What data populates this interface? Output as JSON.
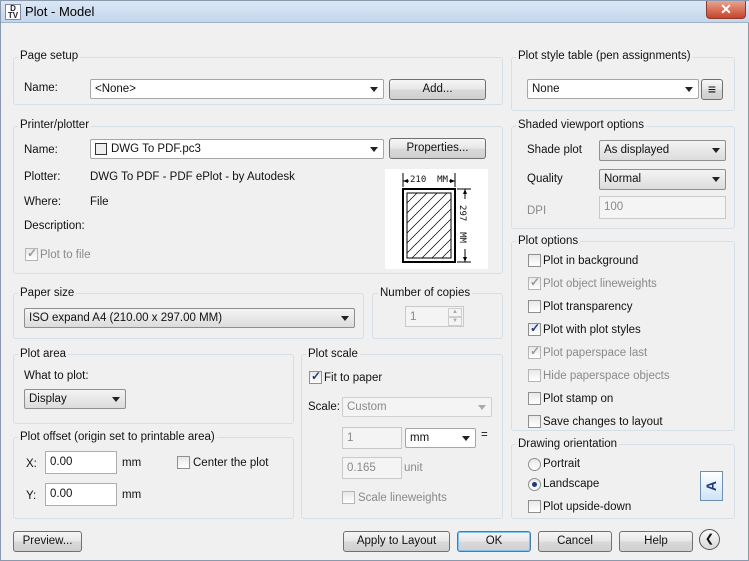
{
  "window": {
    "title": "Plot - Model",
    "app_icon": "D\nTV",
    "close_glyph": "✕"
  },
  "page_setup": {
    "group": "Page setup",
    "name_label": "Name:",
    "name_value": "<None>",
    "add_button": "Add..."
  },
  "printer": {
    "group": "Printer/plotter",
    "name_label": "Name:",
    "name_value": "DWG To PDF.pc3",
    "properties_button": "Properties...",
    "plotter_label": "Plotter:",
    "plotter_value": "DWG To PDF - PDF ePlot - by Autodesk",
    "where_label": "Where:",
    "where_value": "File",
    "description_label": "Description:",
    "plot_to_file": "Plot to file",
    "plot_to_file_checked": true,
    "preview": {
      "width_text": "210  MM",
      "height_text": "297  MM"
    }
  },
  "paper_size": {
    "group": "Paper size",
    "value": "ISO expand A4 (210.00 x 297.00 MM)"
  },
  "copies": {
    "group": "Number of copies",
    "value": "1"
  },
  "plot_area": {
    "group": "Plot area",
    "what_label": "What to plot:",
    "what_value": "Display"
  },
  "plot_offset": {
    "group": "Plot offset (origin set to printable area)",
    "x_label": "X:",
    "x_value": "0.00",
    "x_unit": "mm",
    "y_label": "Y:",
    "y_value": "0.00",
    "y_unit": "mm",
    "center_label": "Center the plot",
    "center_checked": false
  },
  "plot_scale": {
    "group": "Plot scale",
    "fit_label": "Fit to paper",
    "fit_checked": true,
    "scale_label": "Scale:",
    "scale_value": "Custom",
    "val1": "1",
    "unit1": "mm",
    "equals": "=",
    "val2": "0.165",
    "unit2": "unit",
    "lineweights_label": "Scale lineweights",
    "lineweights_checked": false
  },
  "plot_style": {
    "group": "Plot style table (pen assignments)",
    "value": "None",
    "edit_icon": "≡"
  },
  "shaded": {
    "group": "Shaded viewport options",
    "shade_label": "Shade plot",
    "shade_value": "As displayed",
    "quality_label": "Quality",
    "quality_value": "Normal",
    "dpi_label": "DPI",
    "dpi_value": "100"
  },
  "plot_options": {
    "group": "Plot options",
    "items": [
      {
        "label": "Plot in background",
        "checked": false,
        "disabled": false
      },
      {
        "label": "Plot object lineweights",
        "checked": true,
        "disabled": true
      },
      {
        "label": "Plot transparency",
        "checked": false,
        "disabled": false
      },
      {
        "label": "Plot with plot styles",
        "checked": true,
        "disabled": false
      },
      {
        "label": "Plot paperspace last",
        "checked": true,
        "disabled": true
      },
      {
        "label": "Hide paperspace objects",
        "checked": false,
        "disabled": true
      },
      {
        "label": "Plot stamp on",
        "checked": false,
        "disabled": false
      },
      {
        "label": "Save changes to layout",
        "checked": false,
        "disabled": false
      }
    ]
  },
  "orientation": {
    "group": "Drawing orientation",
    "portrait": "Portrait",
    "landscape": "Landscape",
    "selected": "Landscape",
    "upside_down": "Plot upside-down",
    "upside_down_checked": false,
    "icon_letter": "A"
  },
  "footer": {
    "preview": "Preview...",
    "apply": "Apply to Layout",
    "ok": "OK",
    "cancel": "Cancel",
    "help": "Help",
    "collapse_glyph": "❮"
  },
  "check_glyph": "✓"
}
